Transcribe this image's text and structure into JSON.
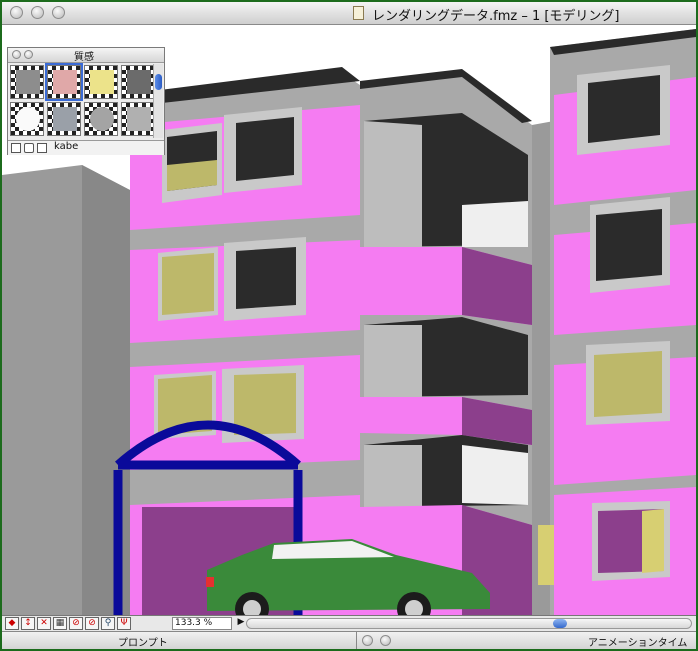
{
  "window": {
    "title": "レンダリングデータ.fmz – 1 [モデリング]"
  },
  "palette": {
    "title": "質感",
    "selected_material": "kabe",
    "swatch_icons": [
      "gray-cube-material",
      "pink-cube-material",
      "yellow-cube-material",
      "dark-cube-material",
      "white-sphere-material",
      "metal-sphere-material",
      "gray-cube-material",
      "gray-cube-material"
    ]
  },
  "statusbar": {
    "zoom": "133.3 %"
  },
  "bottom_panels": {
    "prompt_label": "プロンプト",
    "animation_timeline_label": "アニメーションタイム"
  },
  "scene": {
    "description_colors": {
      "wall_pink": "#f57cf2",
      "wall_gray": "#a8a8a8",
      "arch_blue": "#0a0a9a",
      "car_green": "#3a8a3a"
    }
  }
}
